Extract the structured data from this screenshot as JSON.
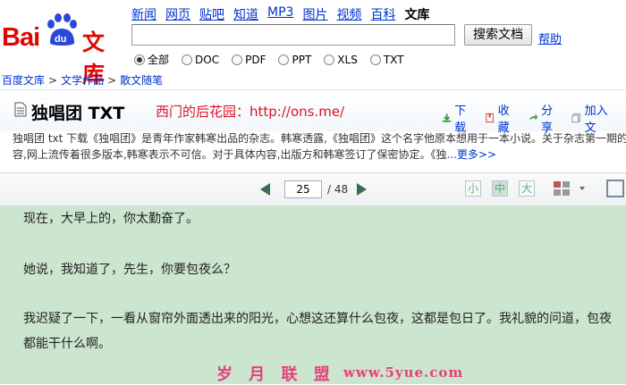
{
  "header": {
    "logo_text_bai": "Bai",
    "logo_text_du": "du",
    "logo_text_wenku": "文库",
    "nav": [
      "新闻",
      "网页",
      "贴吧",
      "知道",
      "MP3",
      "图片",
      "视频",
      "百科",
      "文库"
    ],
    "nav_current": "文库",
    "search_placeholder": "",
    "search_button": "搜索文档",
    "help": "帮助",
    "file_types": [
      {
        "label": "全部",
        "selected": true
      },
      {
        "label": "DOC",
        "selected": false
      },
      {
        "label": "PDF",
        "selected": false
      },
      {
        "label": "PPT",
        "selected": false
      },
      {
        "label": "XLS",
        "selected": false
      },
      {
        "label": "TXT",
        "selected": false
      }
    ]
  },
  "breadcrumb": [
    "百度文库",
    "文学作品",
    "散文随笔"
  ],
  "breadcrumb_sep": ">",
  "doc": {
    "title": "独唱团 TXT",
    "tagline": "西门的后花园：http://ons.me/",
    "actions": [
      {
        "label": "下载",
        "icon": "download-icon"
      },
      {
        "label": "收藏",
        "icon": "bookmark-icon"
      },
      {
        "label": "分享",
        "icon": "share-icon"
      },
      {
        "label": "加入文",
        "icon": "add-doc-icon"
      }
    ],
    "desc_line1": "独唱团 txt 下载《独唱团》是青年作家韩寒出品的杂志。韩寒透露,《独唱团》这个名字他原本想用于一本小说。关于杂志第一期的内",
    "desc_line2": "容,网上流传着很多版本,韩寒表示不可信。对于具体内容,出版方和韩寒签订了保密协定。《独",
    "desc_more": "...更多>>"
  },
  "toolbar": {
    "page_current": "25",
    "page_total": "/ 48",
    "size_small": "小",
    "size_medium": "中",
    "size_large": "大"
  },
  "content": {
    "p1": "现在，大早上的，你太勤奋了。",
    "p2": "她说，我知道了，先生，你要包夜么？",
    "p3_line1": "我迟疑了一下，一看从窗帘外面透出来的阳光，心想这还算什么包夜，这都是包日了。我礼貌的问道，包夜",
    "p3_line2": "都能干什么啊。"
  },
  "watermark": {
    "text": "岁 月 联 盟",
    "url": "www.5yue.com"
  },
  "colors": {
    "brand_red": "#e10601",
    "link_blue": "#0033cc",
    "reading_bg": "#cce5cf",
    "tagline_red": "#dd1122"
  }
}
